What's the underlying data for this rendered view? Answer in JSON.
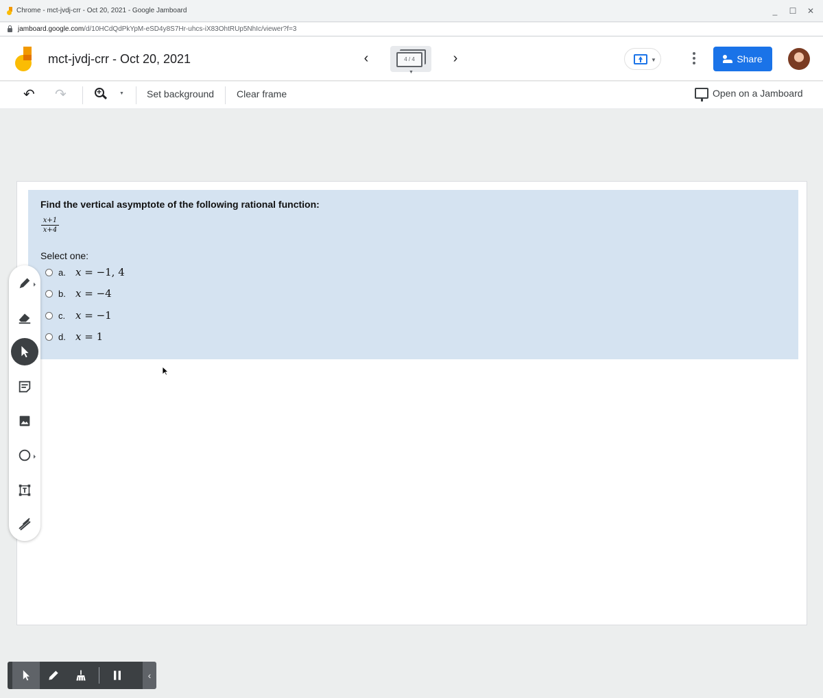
{
  "window": {
    "title": "Chrome - mct-jvdj-crr - Oct 20, 2021 - Google Jamboard",
    "url_host": "jamboard.google.com",
    "url_path": "/d/10HCdQdPkYpM-eSD4y8S7Hr-uhcs-iX83OhtRUp5NhIc/viewer?f=3",
    "controls": [
      "_",
      "☐",
      "✕"
    ]
  },
  "header": {
    "doc_title": "mct-jvdj-crr - Oct 20, 2021",
    "frame_counter": "4 / 4",
    "prev_icon": "chevron-left-icon",
    "next_icon": "chevron-right-icon",
    "share_label": "Share",
    "accent_color": "#1a73e8"
  },
  "toolbar": {
    "set_background": "Set background",
    "clear_frame": "Clear frame",
    "open_on_jamboard": "Open on a Jamboard"
  },
  "quiz": {
    "question": "Find the vertical asymptote of the following rational function:",
    "fraction_numerator": "x+1",
    "fraction_denominator": "x+4",
    "select_label": "Select one:",
    "options": [
      {
        "letter": "a.",
        "var": "x",
        "rhs": " = −1, 4"
      },
      {
        "letter": "b.",
        "var": "x",
        "rhs": " = −4"
      },
      {
        "letter": "c.",
        "var": "x",
        "rhs": " = −1"
      },
      {
        "letter": "d.",
        "var": "x",
        "rhs": " = 1"
      }
    ],
    "background_color": "#d5e3f1"
  },
  "palette": {
    "tools": [
      "pen-icon",
      "eraser-icon",
      "select-icon",
      "sticky-note-icon",
      "image-icon",
      "circle-shape-icon",
      "text-box-icon",
      "laser-icon"
    ],
    "active": "select-icon"
  },
  "annotation_bar": {
    "tools": [
      "pointer-icon",
      "pencil-icon",
      "broom-icon",
      "pause-icon"
    ],
    "collapse_label": "‹"
  }
}
